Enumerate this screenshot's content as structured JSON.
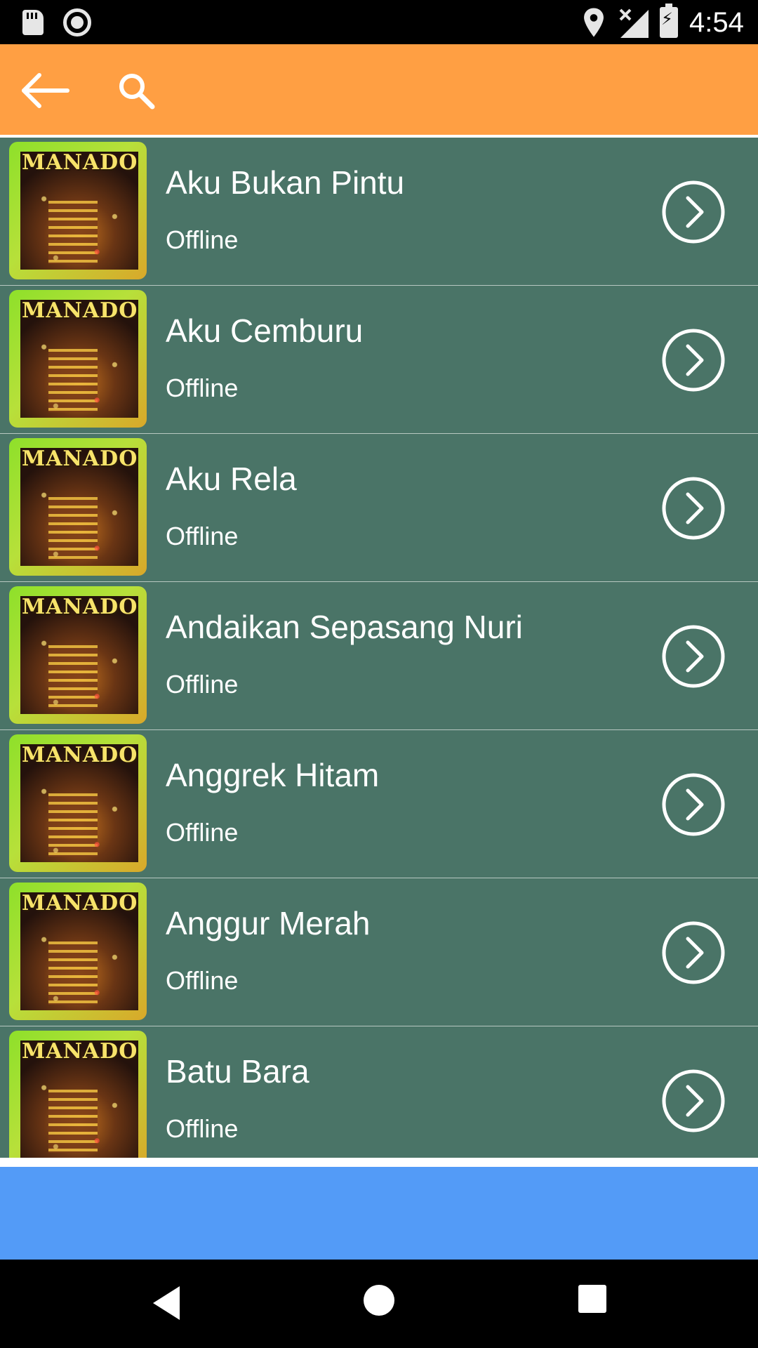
{
  "status_bar": {
    "time": "4:54",
    "icons": [
      "sd-card-icon",
      "record-icon",
      "location-icon",
      "signal-icon",
      "battery-charging-icon"
    ]
  },
  "toolbar": {
    "icons": [
      "back-arrow-icon",
      "search-icon"
    ],
    "background": "#ff9f43"
  },
  "thumbnail": {
    "logo_text": "MANADO"
  },
  "songs": [
    {
      "title": "Aku Bukan Pintu",
      "status": "Offline"
    },
    {
      "title": "Aku Cemburu",
      "status": "Offline"
    },
    {
      "title": "Aku Rela",
      "status": "Offline"
    },
    {
      "title": "Andaikan Sepasang Nuri",
      "status": "Offline"
    },
    {
      "title": "Anggrek Hitam",
      "status": "Offline"
    },
    {
      "title": "Anggur Merah",
      "status": "Offline"
    },
    {
      "title": "Batu Bara",
      "status": "Offline"
    }
  ],
  "colors": {
    "list_background": "#4a7467",
    "ad_banner": "#539bf7"
  },
  "nav_bar": {
    "icons": [
      "nav-back-icon",
      "nav-home-icon",
      "nav-recents-icon"
    ]
  }
}
